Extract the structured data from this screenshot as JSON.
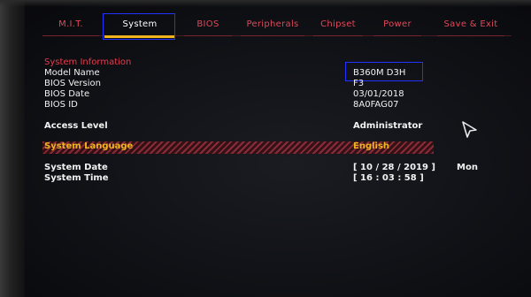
{
  "tabs": [
    {
      "label": "M.I.T."
    },
    {
      "label": "System"
    },
    {
      "label": "BIOS"
    },
    {
      "label": "Peripherals"
    },
    {
      "label": "Chipset"
    },
    {
      "label": "Power"
    },
    {
      "label": "Save & Exit"
    }
  ],
  "active_tab": "System",
  "system_info": {
    "header": "System Information",
    "rows": [
      {
        "label": "Model Name",
        "value": "B360M D3H"
      },
      {
        "label": "BIOS Version",
        "value": "F3"
      },
      {
        "label": "BIOS Date",
        "value": "03/01/2018"
      },
      {
        "label": "BIOS ID",
        "value": "8A0FAG07"
      }
    ]
  },
  "access_level": {
    "label": "Access Level",
    "value": "Administrator"
  },
  "system_language": {
    "label": "System Language",
    "value": "English"
  },
  "system_date": {
    "label": "System Date",
    "value": "[ 10 / 28 / 2019 ]",
    "day": "Mon"
  },
  "system_time": {
    "label": "System Time",
    "value": "[ 16 : 03 : 58 ]"
  },
  "colors": {
    "accent_red": "#e43c4e",
    "active_tab_underline": "#f0b41e",
    "highlight_box": "#2233ff",
    "selected_item_text": "#f0b41e"
  },
  "icons": [
    "mouse-cursor-icon"
  ]
}
